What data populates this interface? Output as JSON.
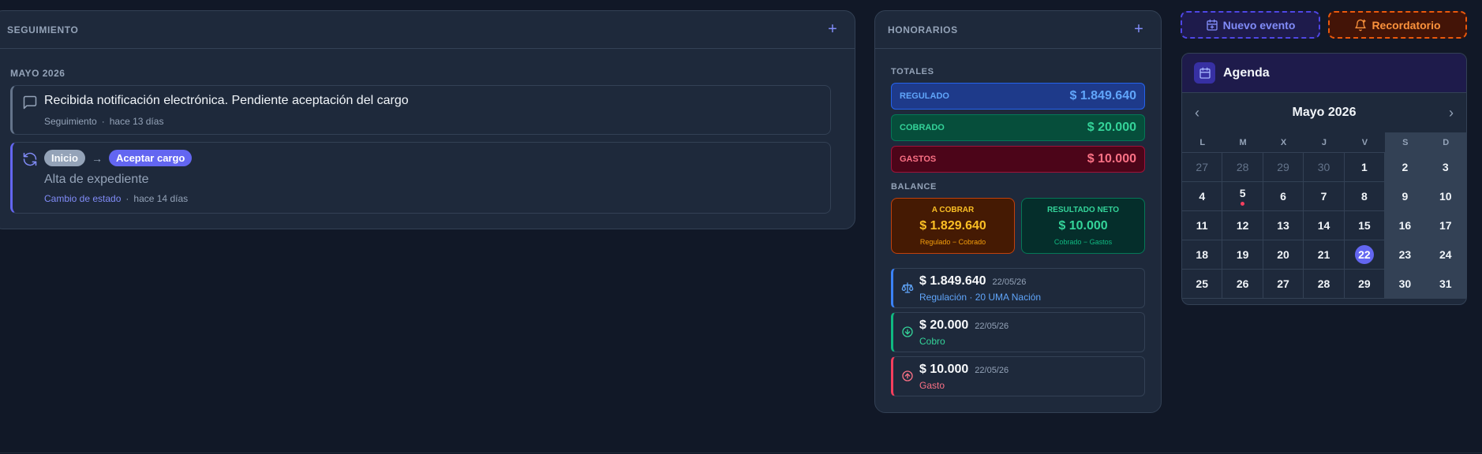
{
  "seguimiento": {
    "title": "SEGUIMIENTO",
    "add_icon": "plus-icon",
    "month": "MAYO 2026",
    "entries": [
      {
        "icon": "message-icon",
        "title": "Recibida notificación electrónica. Pendiente aceptación del cargo",
        "type": "Seguimiento",
        "time": "hace 13 días"
      },
      {
        "icon": "refresh-icon",
        "from_state": "Inicio",
        "to_state": "Aceptar cargo",
        "description": "Alta de expediente",
        "type": "Cambio de estado",
        "time": "hace 14 días"
      }
    ]
  },
  "honorarios": {
    "title": "HONORARIOS",
    "add_icon": "plus-icon",
    "totales_label": "TOTALES",
    "totales": [
      {
        "label": "REGULADO",
        "value": "$ 1.849.640"
      },
      {
        "label": "COBRADO",
        "value": "$ 20.000"
      },
      {
        "label": "GASTOS",
        "value": "$ 10.000"
      }
    ],
    "balance_label": "BALANCE",
    "balance": [
      {
        "label": "A COBRAR",
        "value": "$ 1.829.640",
        "formula": "Regulado − Cobrado"
      },
      {
        "label": "RESULTADO NETO",
        "value": "$ 10.000",
        "formula": "Cobrado − Gastos"
      }
    ],
    "movimientos": [
      {
        "icon": "scale-icon",
        "amount": "$ 1.849.640",
        "date": "22/05/26",
        "detail": "Regulación · 20 UMA Nación",
        "color": "#60a5fa"
      },
      {
        "icon": "arrow-down-circle-icon",
        "amount": "$ 20.000",
        "date": "22/05/26",
        "detail": "Cobro",
        "color": "#34d399"
      },
      {
        "icon": "arrow-up-circle-icon",
        "amount": "$ 10.000",
        "date": "22/05/26",
        "detail": "Gasto",
        "color": "#fb7185"
      }
    ]
  },
  "actions": {
    "nuevo_evento": "Nuevo evento",
    "recordatorio": "Recordatorio"
  },
  "agenda": {
    "title": "Agenda",
    "month": "Mayo 2026",
    "weekdays": [
      "L",
      "M",
      "X",
      "J",
      "V",
      "S",
      "D"
    ],
    "today": 22,
    "event_days": [
      5
    ],
    "weeks": [
      [
        {
          "d": "27",
          "out": true
        },
        {
          "d": "28",
          "out": true
        },
        {
          "d": "29",
          "out": true
        },
        {
          "d": "30",
          "out": true
        },
        {
          "d": "1"
        },
        {
          "d": "2"
        },
        {
          "d": "3"
        }
      ],
      [
        {
          "d": "4"
        },
        {
          "d": "5"
        },
        {
          "d": "6"
        },
        {
          "d": "7"
        },
        {
          "d": "8"
        },
        {
          "d": "9"
        },
        {
          "d": "10"
        }
      ],
      [
        {
          "d": "11"
        },
        {
          "d": "12"
        },
        {
          "d": "13"
        },
        {
          "d": "14"
        },
        {
          "d": "15"
        },
        {
          "d": "16"
        },
        {
          "d": "17"
        }
      ],
      [
        {
          "d": "18"
        },
        {
          "d": "19"
        },
        {
          "d": "20"
        },
        {
          "d": "21"
        },
        {
          "d": "22"
        },
        {
          "d": "23"
        },
        {
          "d": "24"
        }
      ],
      [
        {
          "d": "25"
        },
        {
          "d": "26"
        },
        {
          "d": "27"
        },
        {
          "d": "28"
        },
        {
          "d": "29"
        },
        {
          "d": "30"
        },
        {
          "d": "31"
        }
      ]
    ]
  }
}
